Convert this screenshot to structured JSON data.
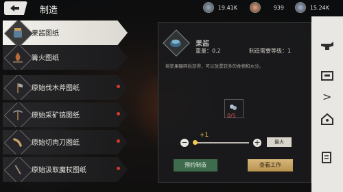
{
  "header": {
    "title": "制造",
    "resources": [
      {
        "icon": "silver-coin-icon",
        "value": "19.41K"
      },
      {
        "icon": "copper-coin-icon",
        "value": "939"
      },
      {
        "icon": "gem-icon",
        "value": "15.24K"
      }
    ]
  },
  "recipes": [
    {
      "label": "果酱图纸",
      "selected": true,
      "alert": false
    },
    {
      "label": "篝火图纸",
      "selected": false,
      "alert": false
    },
    {
      "label": "原始伐木斧图纸",
      "selected": false,
      "alert": true
    },
    {
      "label": "原始采矿镐图纸",
      "selected": false,
      "alert": true
    },
    {
      "label": "原始切肉刀图纸",
      "selected": false,
      "alert": true
    },
    {
      "label": "原始汲取魔杖图纸",
      "selected": false,
      "alert": true
    }
  ],
  "detail": {
    "name": "果酱",
    "weight": "重量：0.2",
    "level": "制造需要等级：1",
    "description": "将浆果碾碎后获得，可以放置较多的食物和水分。",
    "material_count": "0/5",
    "quantity_delta": "+1",
    "max_label": "最大",
    "reserve_label": "预约制造",
    "view_label": "查看工作"
  },
  "colors": {
    "accent_gold": "#f2c94c",
    "alert_red": "#d03a2c",
    "reserve_green": "#3d6b4b"
  }
}
